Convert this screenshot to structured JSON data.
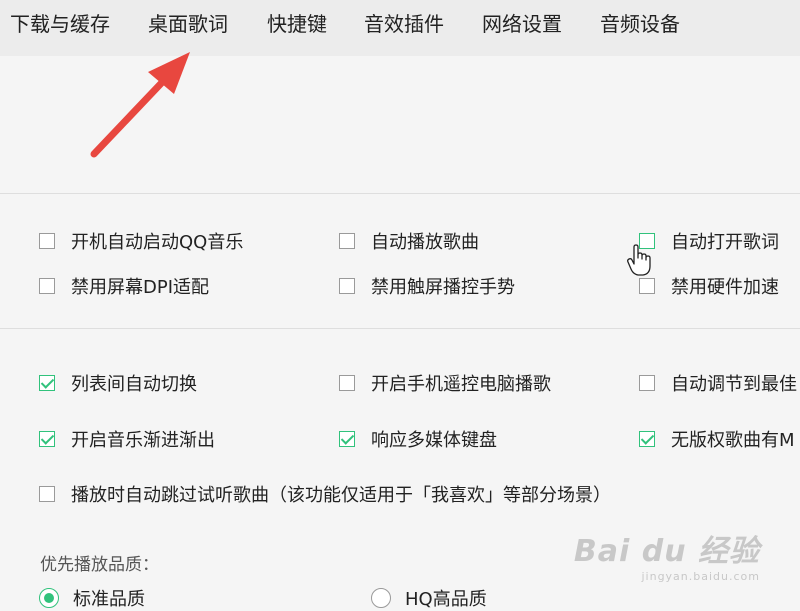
{
  "tabs": [
    "下载与缓存",
    "桌面歌词",
    "快捷键",
    "音效插件",
    "网络设置",
    "音频设备"
  ],
  "options_group1": [
    {
      "label": "开机自动启动QQ音乐",
      "checked": false
    },
    {
      "label": "自动播放歌曲",
      "checked": false
    },
    {
      "label": "自动打开歌词",
      "checked": false
    },
    {
      "label": "禁用屏幕DPI适配",
      "checked": false
    },
    {
      "label": "禁用触屏播控手势",
      "checked": false
    },
    {
      "label": "禁用硬件加速",
      "checked": false
    }
  ],
  "options_group2": [
    {
      "label": "列表间自动切换",
      "checked": true
    },
    {
      "label": "开启手机遥控电脑播歌",
      "checked": false
    },
    {
      "label": "自动调节到最佳",
      "checked": false
    },
    {
      "label": "开启音乐渐进渐出",
      "checked": true
    },
    {
      "label": "响应多媒体键盘",
      "checked": true
    },
    {
      "label": "无版权歌曲有M",
      "checked": true
    },
    {
      "label": "播放时自动跳过试听歌曲（该功能仅适用于「我喜欢」等部分场景）",
      "checked": false
    }
  ],
  "quality": {
    "heading": "优先播放品质：",
    "options": [
      "标准品质",
      "HQ高品质"
    ],
    "selected_index": 0
  },
  "watermark": {
    "logo": "Bai du 经验",
    "url": "jingyan.baidu.com"
  },
  "colors": {
    "accent": "#31c27c",
    "arrow": "#e8473f"
  }
}
